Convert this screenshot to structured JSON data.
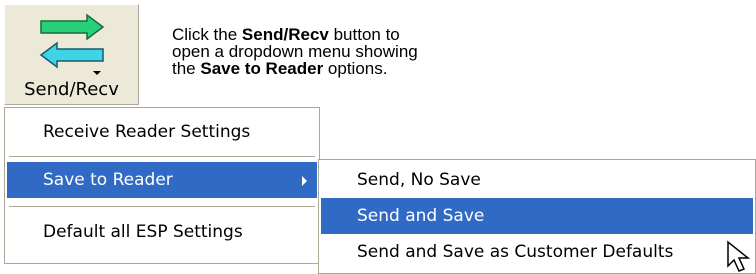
{
  "toolbar": {
    "send_recv_label": "Send/Recv"
  },
  "callout": {
    "line1_prefix": "Click the ",
    "line1_bold": "Send/Recv",
    "line1_suffix": " button to",
    "line2": "open a dropdown menu showing",
    "line3_prefix": "the ",
    "line3_bold": "Save to Reader",
    "line3_suffix": " options."
  },
  "main_menu": {
    "items": [
      {
        "label": "Receive Reader Settings"
      },
      {
        "label": "Save to Reader"
      },
      {
        "label": "Default all ESP Settings"
      }
    ],
    "selected_index": 1
  },
  "submenu": {
    "items": [
      {
        "label": "Send, No Save"
      },
      {
        "label": "Send and Save"
      },
      {
        "label": "Send and Save as Customer Defaults"
      }
    ],
    "selected_index": 1
  },
  "colors": {
    "selection": "#316ac5",
    "arrow_green": "#27d07a",
    "arrow_cyan": "#3fd3e8"
  },
  "icons": {
    "send_recv": "swap-arrows-icon",
    "submenu_arrow": "triangle-right-icon",
    "cursor": "mouse-pointer-icon"
  }
}
